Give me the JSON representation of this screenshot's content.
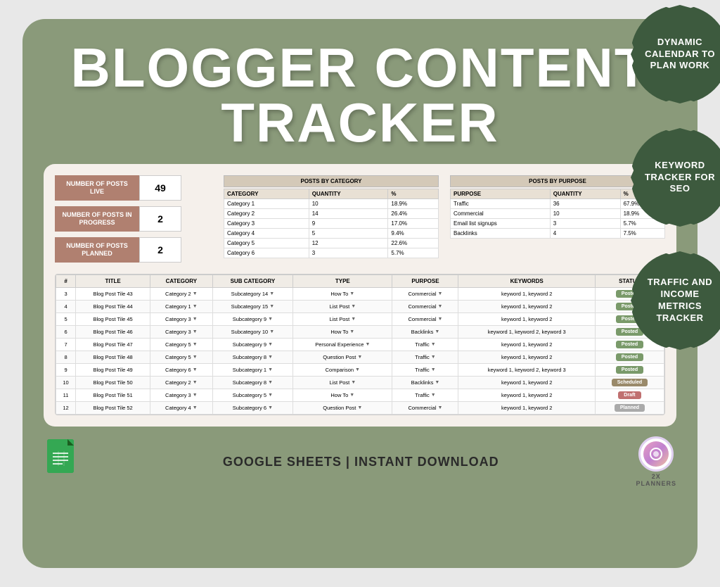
{
  "card": {
    "title_line1": "BLOGGER CONTENT",
    "title_line2": "TRACKER"
  },
  "badges": [
    {
      "id": "badge-1",
      "text": "DYNAMIC CALENDAR TO PLAN WORK"
    },
    {
      "id": "badge-2",
      "text": "KEYWORD TRACKER FOR SEO"
    },
    {
      "id": "badge-3",
      "text": "TRAFFIC AND INCOME METRICS TRACKER"
    }
  ],
  "stats": [
    {
      "label": "NUMBER OF POSTS LIVE",
      "value": "49"
    },
    {
      "label": "NUMBER OF POSTS IN PROGRESS",
      "value": "2"
    },
    {
      "label": "NUMBER OF POSTS PLANNED",
      "value": "2"
    }
  ],
  "posts_by_category": {
    "title": "POSTS BY CATEGORY",
    "headers": [
      "CATEGORY",
      "QUANTITY",
      "%"
    ],
    "rows": [
      [
        "Category 1",
        "10",
        "18.9%"
      ],
      [
        "Category 2",
        "14",
        "26.4%"
      ],
      [
        "Category 3",
        "9",
        "17.0%"
      ],
      [
        "Category 4",
        "5",
        "9.4%"
      ],
      [
        "Category 5",
        "12",
        "22.6%"
      ],
      [
        "Category 6",
        "3",
        "5.7%"
      ]
    ]
  },
  "posts_by_purpose": {
    "title": "POSTS BY PURPOSE",
    "headers": [
      "PURPOSE",
      "QUANTITY",
      "%"
    ],
    "rows": [
      [
        "Traffic",
        "36",
        "67.9%"
      ],
      [
        "Commercial",
        "10",
        "18.9%"
      ],
      [
        "Email list signups",
        "3",
        "5.7%"
      ],
      [
        "Backlinks",
        "4",
        "7.5%"
      ]
    ]
  },
  "main_table": {
    "headers": [
      "#",
      "TITLE",
      "CATEGORY",
      "SUB CATEGORY",
      "TYPE",
      "PURPOSE",
      "KEYWORDS",
      "STATUS"
    ],
    "rows": [
      {
        "num": "3",
        "title": "Blog Post Tile 43",
        "category": "Category 2",
        "subcategory": "Subcategory 14",
        "type": "How To",
        "purpose": "Commercial",
        "keywords": "keyword 1, keyword 2",
        "status": "Posted",
        "status_type": "posted"
      },
      {
        "num": "4",
        "title": "Blog Post Tile 44",
        "category": "Category 1",
        "subcategory": "Subcategory 15",
        "type": "List Post",
        "purpose": "Commercial",
        "keywords": "keyword 1, keyword 2",
        "status": "Posted",
        "status_type": "posted"
      },
      {
        "num": "5",
        "title": "Blog Post Tile 45",
        "category": "Category 3",
        "subcategory": "Subcategory 9",
        "type": "List Post",
        "purpose": "Commercial",
        "keywords": "keyword 1, keyword 2",
        "status": "Posted",
        "status_type": "posted"
      },
      {
        "num": "6",
        "title": "Blog Post Tile 46",
        "category": "Category 3",
        "subcategory": "Subcategory 10",
        "type": "How To",
        "purpose": "Backlinks",
        "keywords": "keyword 1, keyword 2, keyword 3",
        "status": "Posted",
        "status_type": "posted"
      },
      {
        "num": "7",
        "title": "Blog Post Tile 47",
        "category": "Category 5",
        "subcategory": "Subcategory 9",
        "type": "Personal Experience",
        "purpose": "Traffic",
        "keywords": "keyword 1, keyword 2",
        "status": "Posted",
        "status_type": "posted"
      },
      {
        "num": "8",
        "title": "Blog Post Tile 48",
        "category": "Category 5",
        "subcategory": "Subcategory 8",
        "type": "Question Post",
        "purpose": "Traffic",
        "keywords": "keyword 1, keyword 2",
        "status": "Posted",
        "status_type": "posted"
      },
      {
        "num": "9",
        "title": "Blog Post Tile 49",
        "category": "Category 6",
        "subcategory": "Subcategory 1",
        "type": "Comparison",
        "purpose": "Traffic",
        "keywords": "keyword 1, keyword 2, keyword 3",
        "status": "Posted",
        "status_type": "posted"
      },
      {
        "num": "10",
        "title": "Blog Post Tile 50",
        "category": "Category 2",
        "subcategory": "Subcategory 8",
        "type": "List Post",
        "purpose": "Backlinks",
        "keywords": "keyword 1, keyword 2",
        "status": "Scheduled",
        "status_type": "scheduled"
      },
      {
        "num": "11",
        "title": "Blog Post Tile 51",
        "category": "Category 3",
        "subcategory": "Subcategory 5",
        "type": "How To",
        "purpose": "Traffic",
        "keywords": "keyword 1, keyword 2",
        "status": "Draft",
        "status_type": "draft"
      },
      {
        "num": "12",
        "title": "Blog Post Tile 52",
        "category": "Category 4",
        "subcategory": "Subcategory 6",
        "type": "Question Post",
        "purpose": "Commercial",
        "keywords": "keyword 1, keyword 2",
        "status": "Planned",
        "status_type": "planned"
      }
    ]
  },
  "bottom": {
    "cta_text": "GOOGLE SHEETS | INSTANT DOWNLOAD",
    "brand_name": "2X\nPLANNERS"
  }
}
